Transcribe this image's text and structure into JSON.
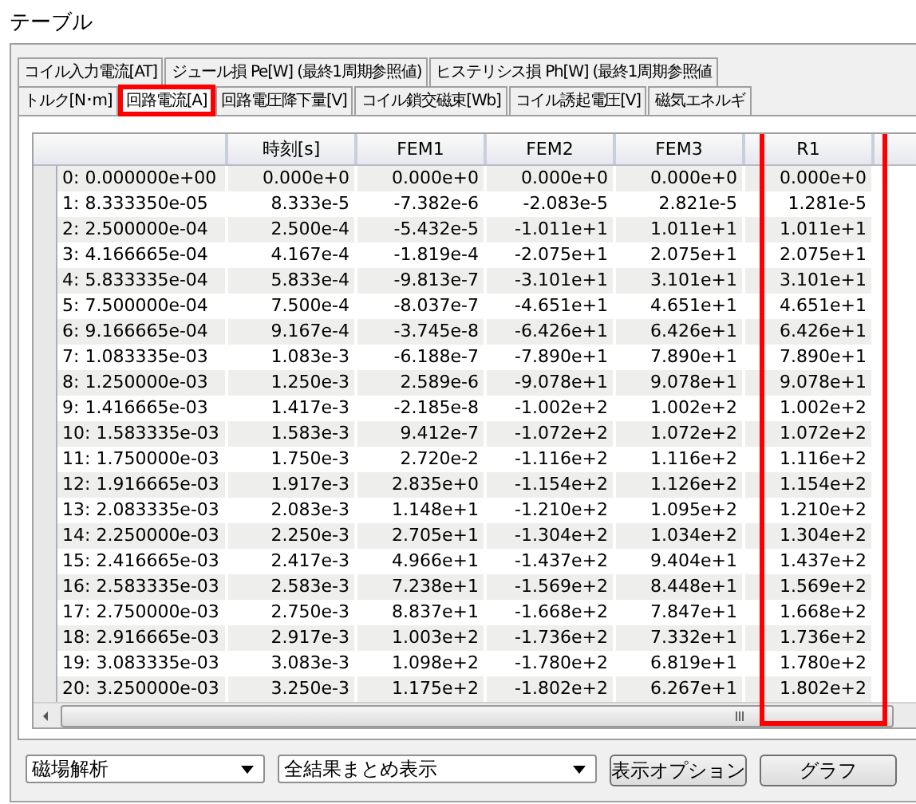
{
  "window": {
    "title": "テーブル"
  },
  "tab_rows": [
    [
      {
        "label": "コイル入力電流[AT]",
        "selected": false,
        "highlighted": false
      },
      {
        "label": "ジュール損 Pe[W] (最終1周期参照値)",
        "selected": false,
        "highlighted": false
      },
      {
        "label": "ヒステリシス損 Ph[W] (最終1周期参照値",
        "selected": false,
        "highlighted": false
      }
    ],
    [
      {
        "label": "トルク[N･m]",
        "selected": false,
        "highlighted": false
      },
      {
        "label": "回路電流[A]",
        "selected": true,
        "highlighted": true
      },
      {
        "label": "回路電圧降下量[V]",
        "selected": false,
        "highlighted": false
      },
      {
        "label": "コイル鎖交磁束[Wb]",
        "selected": false,
        "highlighted": false
      },
      {
        "label": "コイル誘起電圧[V]",
        "selected": false,
        "highlighted": false
      },
      {
        "label": "磁気エネルギ",
        "selected": false,
        "highlighted": false
      }
    ]
  ],
  "table": {
    "columns": [
      {
        "label": "時刻[s]",
        "highlighted": false
      },
      {
        "label": "FEM1",
        "highlighted": false
      },
      {
        "label": "FEM2",
        "highlighted": false
      },
      {
        "label": "FEM3",
        "highlighted": false
      },
      {
        "label": "R1",
        "highlighted": true
      }
    ],
    "rows": [
      {
        "step": "0: 0.000000e+00",
        "cells": [
          "0.000e+0",
          "0.000e+0",
          "0.000e+0",
          "0.000e+0",
          "0.000e+0"
        ]
      },
      {
        "step": "1: 8.333350e-05",
        "cells": [
          "8.333e-5",
          "-7.382e-6",
          "-2.083e-5",
          "2.821e-5",
          "1.281e-5"
        ]
      },
      {
        "step": "2: 2.500000e-04",
        "cells": [
          "2.500e-4",
          "-5.432e-5",
          "-1.011e+1",
          "1.011e+1",
          "1.011e+1"
        ]
      },
      {
        "step": "3: 4.166665e-04",
        "cells": [
          "4.167e-4",
          "-1.819e-4",
          "-2.075e+1",
          "2.075e+1",
          "2.075e+1"
        ]
      },
      {
        "step": "4: 5.833335e-04",
        "cells": [
          "5.833e-4",
          "-9.813e-7",
          "-3.101e+1",
          "3.101e+1",
          "3.101e+1"
        ]
      },
      {
        "step": "5: 7.500000e-04",
        "cells": [
          "7.500e-4",
          "-8.037e-7",
          "-4.651e+1",
          "4.651e+1",
          "4.651e+1"
        ]
      },
      {
        "step": "6: 9.166665e-04",
        "cells": [
          "9.167e-4",
          "-3.745e-8",
          "-6.426e+1",
          "6.426e+1",
          "6.426e+1"
        ]
      },
      {
        "step": "7: 1.083335e-03",
        "cells": [
          "1.083e-3",
          "-6.188e-7",
          "-7.890e+1",
          "7.890e+1",
          "7.890e+1"
        ]
      },
      {
        "step": "8: 1.250000e-03",
        "cells": [
          "1.250e-3",
          "2.589e-6",
          "-9.078e+1",
          "9.078e+1",
          "9.078e+1"
        ]
      },
      {
        "step": "9: 1.416665e-03",
        "cells": [
          "1.417e-3",
          "-2.185e-8",
          "-1.002e+2",
          "1.002e+2",
          "1.002e+2"
        ]
      },
      {
        "step": "10: 1.583335e-03",
        "cells": [
          "1.583e-3",
          "9.412e-7",
          "-1.072e+2",
          "1.072e+2",
          "1.072e+2"
        ]
      },
      {
        "step": "11: 1.750000e-03",
        "cells": [
          "1.750e-3",
          "2.720e-2",
          "-1.116e+2",
          "1.116e+2",
          "1.116e+2"
        ]
      },
      {
        "step": "12: 1.916665e-03",
        "cells": [
          "1.917e-3",
          "2.835e+0",
          "-1.154e+2",
          "1.126e+2",
          "1.154e+2"
        ]
      },
      {
        "step": "13: 2.083335e-03",
        "cells": [
          "2.083e-3",
          "1.148e+1",
          "-1.210e+2",
          "1.095e+2",
          "1.210e+2"
        ]
      },
      {
        "step": "14: 2.250000e-03",
        "cells": [
          "2.250e-3",
          "2.705e+1",
          "-1.304e+2",
          "1.034e+2",
          "1.304e+2"
        ]
      },
      {
        "step": "15: 2.416665e-03",
        "cells": [
          "2.417e-3",
          "4.966e+1",
          "-1.437e+2",
          "9.404e+1",
          "1.437e+2"
        ]
      },
      {
        "step": "16: 2.583335e-03",
        "cells": [
          "2.583e-3",
          "7.238e+1",
          "-1.569e+2",
          "8.448e+1",
          "1.569e+2"
        ]
      },
      {
        "step": "17: 2.750000e-03",
        "cells": [
          "2.750e-3",
          "8.837e+1",
          "-1.668e+2",
          "7.847e+1",
          "1.668e+2"
        ]
      },
      {
        "step": "18: 2.916665e-03",
        "cells": [
          "2.917e-3",
          "1.003e+2",
          "-1.736e+2",
          "7.332e+1",
          "1.736e+2"
        ]
      },
      {
        "step": "19: 3.083335e-03",
        "cells": [
          "3.083e-3",
          "1.098e+2",
          "-1.780e+2",
          "6.819e+1",
          "1.780e+2"
        ]
      },
      {
        "step": "20: 3.250000e-03",
        "cells": [
          "3.250e-3",
          "1.175e+2",
          "-1.802e+2",
          "6.267e+1",
          "1.802e+2"
        ]
      }
    ]
  },
  "bottom": {
    "dropdowns": [
      "磁場解析",
      "全結果まとめ表示"
    ],
    "buttons": [
      "表示オプション",
      "グラフ"
    ]
  }
}
